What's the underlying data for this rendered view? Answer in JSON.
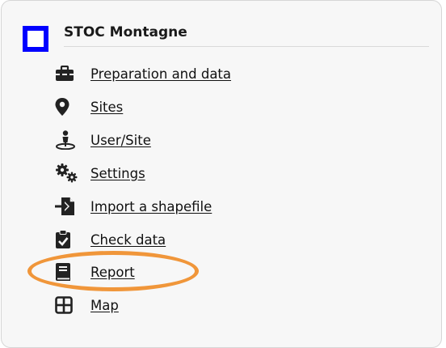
{
  "panel": {
    "title": "STOC Montagne",
    "icon_color": "#0000ff",
    "highlight_color": "#f0963a"
  },
  "menu": {
    "items": [
      {
        "label": "Preparation and data",
        "icon": "toolbox-icon"
      },
      {
        "label": "Sites",
        "icon": "map-marker-icon"
      },
      {
        "label": "User/Site",
        "icon": "user-location-icon"
      },
      {
        "label": "Settings",
        "icon": "gears-icon"
      },
      {
        "label": "Import a shapefile",
        "icon": "file-import-icon"
      },
      {
        "label": "Check data",
        "icon": "clipboard-check-icon"
      },
      {
        "label": "Report",
        "icon": "book-icon"
      },
      {
        "label": "Map",
        "icon": "grid-map-icon"
      }
    ],
    "highlighted_item": "Report"
  }
}
